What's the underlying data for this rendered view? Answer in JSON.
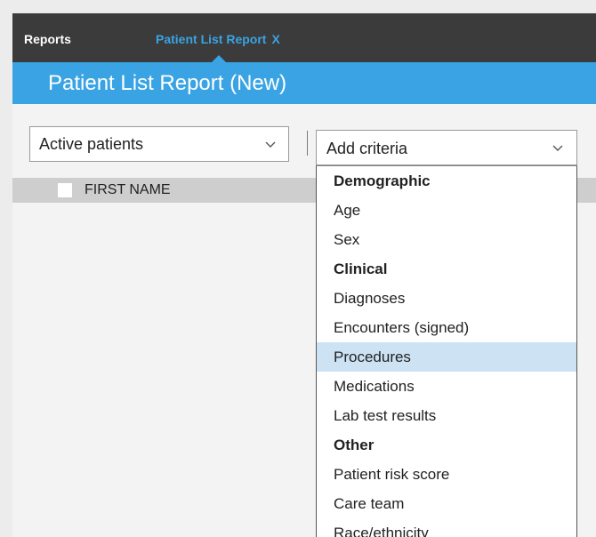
{
  "tabs": {
    "reports_label": "Reports",
    "active_label": "Patient List Report",
    "active_close": "X"
  },
  "page": {
    "title": "Patient List Report (New)"
  },
  "filters": {
    "status_value": "Active patients",
    "criteria_value": "Add criteria"
  },
  "table": {
    "columns": [
      "FIRST NAME"
    ]
  },
  "criteria_menu": {
    "highlighted": "Procedures",
    "items": [
      {
        "label": "Demographic",
        "type": "group"
      },
      {
        "label": "Age",
        "type": "option"
      },
      {
        "label": "Sex",
        "type": "option"
      },
      {
        "label": "Clinical",
        "type": "group"
      },
      {
        "label": "Diagnoses",
        "type": "option"
      },
      {
        "label": "Encounters (signed)",
        "type": "option"
      },
      {
        "label": "Procedures",
        "type": "option"
      },
      {
        "label": "Medications",
        "type": "option"
      },
      {
        "label": "Lab test results",
        "type": "option"
      },
      {
        "label": "Other",
        "type": "group"
      },
      {
        "label": "Patient risk score",
        "type": "option"
      },
      {
        "label": "Care team",
        "type": "option"
      },
      {
        "label": "Race/ethnicity",
        "type": "option"
      }
    ]
  },
  "colors": {
    "top_bar": "#3b3b3b",
    "accent_blue": "#3aa3e3",
    "highlight": "#cde3f4",
    "header_band": "#cecece"
  },
  "icons": {
    "dropdown_chevron": "chevron-down-icon"
  }
}
